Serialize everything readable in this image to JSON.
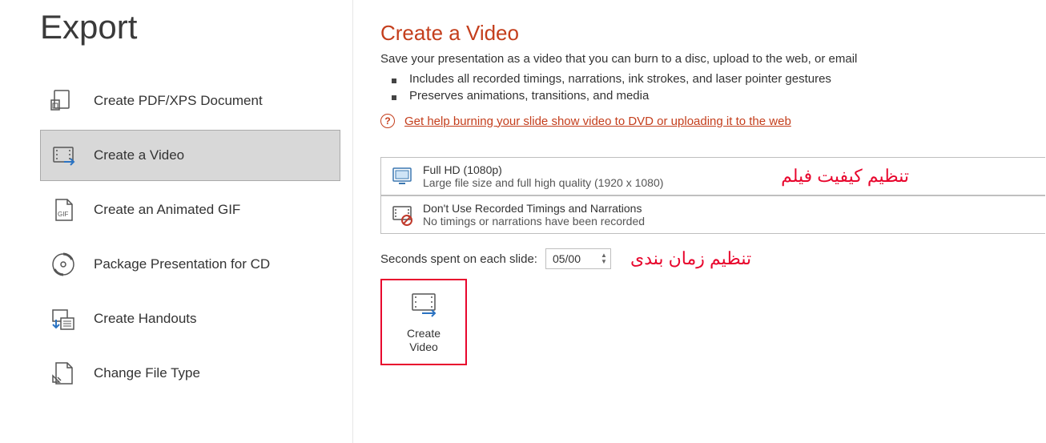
{
  "page_title": "Export",
  "sidebar": {
    "items": [
      {
        "label": "Create PDF/XPS Document"
      },
      {
        "label": "Create a Video"
      },
      {
        "label": "Create an Animated GIF"
      },
      {
        "label": "Package Presentation for CD"
      },
      {
        "label": "Create Handouts"
      },
      {
        "label": "Change File Type"
      }
    ],
    "selected_index": 1
  },
  "detail": {
    "title": "Create a Video",
    "description": "Save your presentation as a video that you can burn to a disc, upload to the web, or email",
    "bullets": [
      "Includes all recorded timings, narrations, ink strokes, and laser pointer gestures",
      "Preserves animations, transitions, and media"
    ],
    "help_link": "Get help burning your slide show video to DVD or uploading it to the web",
    "quality": {
      "title": "Full HD (1080p)",
      "subtitle": "Large file size and full high quality (1920 x 1080)",
      "callout": "تنظیم کیفیت فیلم"
    },
    "timings": {
      "title": "Don't Use Recorded Timings and Narrations",
      "subtitle": "No timings or narrations have been recorded"
    },
    "seconds_label": "Seconds spent on each slide:",
    "seconds_value": "05/00",
    "seconds_callout": "تنظیم زمان بندی",
    "create_button": "Create\nVideo"
  }
}
